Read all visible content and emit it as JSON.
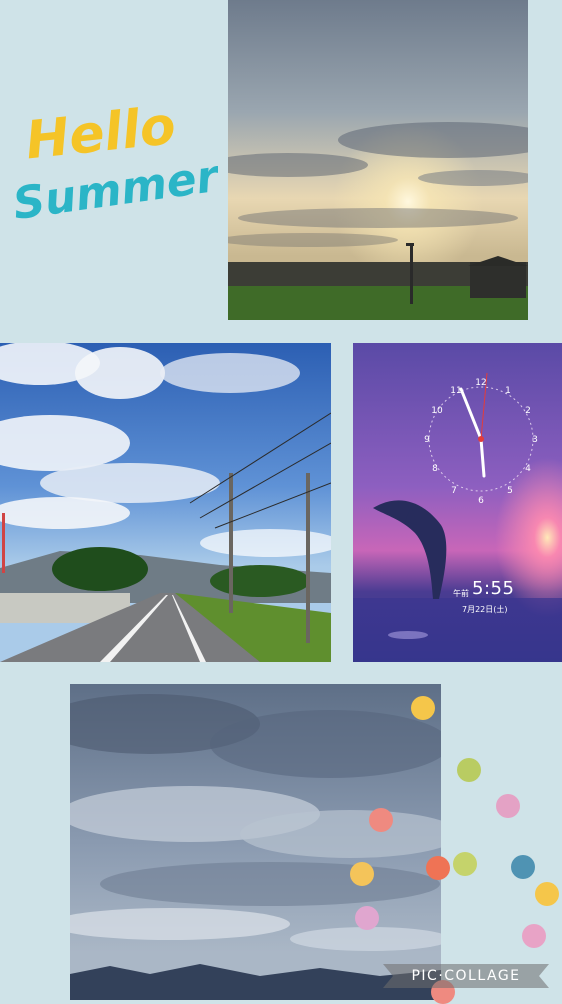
{
  "sticker": {
    "line1": "Hello",
    "line2": "Summer"
  },
  "clock": {
    "time": "5:55",
    "ampm": "午前",
    "date": "7月22日(土)"
  },
  "watermark": {
    "text": "PIC·COLLAGE"
  },
  "colors": {
    "background": "#cfe3e8",
    "sticker_yellow": "#f5c427",
    "sticker_teal": "#2bb5c7"
  }
}
